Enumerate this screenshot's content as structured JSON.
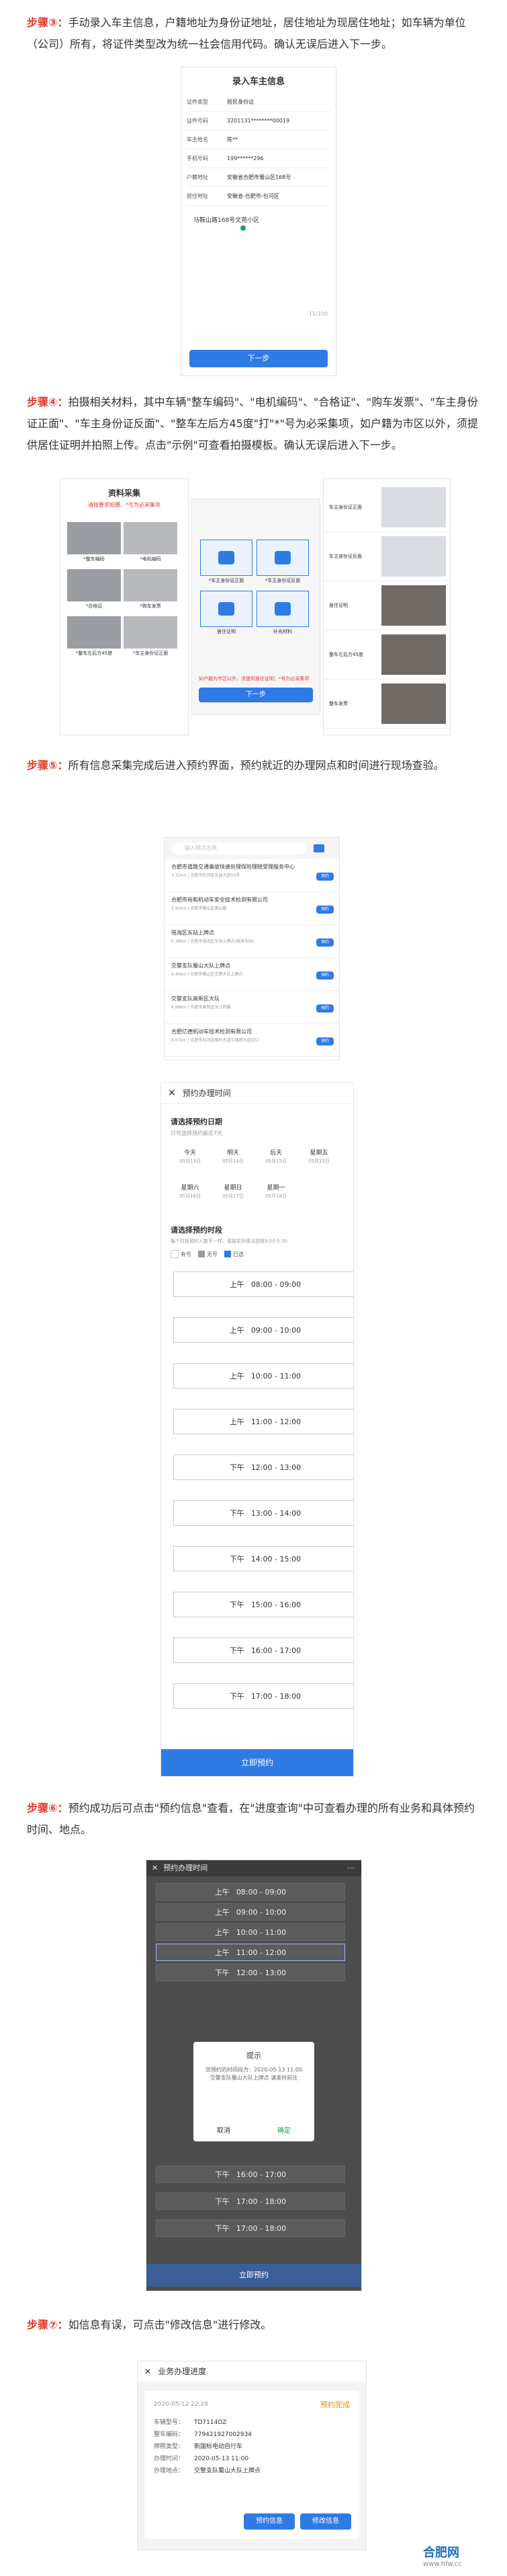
{
  "step3": {
    "label": "步骤③：",
    "text": "手动录入车主信息，户籍地址为身份证地址，居住地址为现居住地址；如车辆为单位（公司）所有，将证件类型改为统一社会信用代码。确认无误后进入下一步。"
  },
  "step4": {
    "label": "步骤④：",
    "text": "拍摄相关材料，其中车辆\"整车编码\"、\"电机编码\"、\"合格证\"、\"购车发票\"、\"车主身份证正面\"、\"车主身份证反面\"、\"整车左后方45度\"打\"*\"号为必采集项，如户籍为市区以外，须提供居住证明并拍照上传。点击\"示例\"可查看拍摄模板。确认无误后进入下一步。"
  },
  "step5": {
    "label": "步骤⑤：",
    "text": "所有信息采集完成后进入预约界面，预约就近的办理网点和时间进行现场查验。"
  },
  "step6": {
    "label": "步骤⑥：",
    "text": "预约成功后可点击\"预约信息\"查看，在\"进度查询\"中可查看办理的所有业务和具体预约时间、地点。"
  },
  "step7": {
    "label": "步骤⑦：",
    "text": "如信息有误，可点击\"修改信息\"进行修改。"
  },
  "owner_form": {
    "title": "录入车主信息",
    "fields": [
      {
        "label": "证件类型",
        "value": "居民身份证"
      },
      {
        "label": "证件号码",
        "value": "3201131********00019"
      },
      {
        "label": "车主姓名",
        "value": "陈**"
      },
      {
        "label": "手机号码",
        "value": "199******296"
      },
      {
        "label": "户籍地址",
        "value": "安徽省合肥市蜀山区168号"
      },
      {
        "label": "居住地址",
        "value": "安徽省-合肥市-包河区"
      }
    ],
    "address_detail": "马鞍山路168号文苑小区",
    "counter": "15/100",
    "next": "下一步"
  },
  "materials": {
    "title": "资料采集",
    "note": "请按要求拍摄，*号为必采集项",
    "items": [
      "*整车编码",
      "*电机编码",
      "*合格证",
      "*购车发票",
      "*整车左后方45度",
      "*车主身份证正面"
    ],
    "id_front": "*车主身份证正面",
    "id_back": "*车主身份证反面",
    "idcard_items": [
      "*车主身份证正面",
      "*车主身份证反面",
      "居住证明",
      "补充材料"
    ],
    "mid_hint": "如户籍为市区以外，须提供居住证明；*号为必采集项",
    "next": "下一步",
    "right_items": [
      "车主身份证正面",
      "车主身份证反面",
      "居住证明",
      "整车左后方45度",
      "整车发票"
    ]
  },
  "outlets": {
    "search_placeholder": "输入网点名称",
    "list": [
      {
        "name": "合肥市道路交通事故快速处理保险理赔受理服务中心",
        "meta": "3.32km | 合肥市包河区花园大道55号",
        "btn": "预约"
      },
      {
        "name": "合肥市裕和机动车安全技术检测有限公司",
        "meta": "3.95km | 合肥市蜀山区黄山路",
        "btn": "预约"
      },
      {
        "name": "瑶海区东站上牌点",
        "meta": "6.38km | 合肥市瑶海区东站上牌点(瑶海东站)",
        "btn": "预约"
      },
      {
        "name": "交警支队蜀山大队上牌点",
        "meta": "6.44km | 合肥市蜀山区交警大队上牌点",
        "btn": "预约"
      },
      {
        "name": "交警支队高新区大队",
        "meta": "6.98km | 合肥市高新区长江西路",
        "btn": "预约"
      },
      {
        "name": "合肥亿德机动车技术检测有限公司",
        "meta": "8.07km | 合肥市包河区徽州大道与锦绣大道交口",
        "btn": "预约"
      }
    ]
  },
  "booking": {
    "title": "预约办理时间",
    "date_heading": "请选择预约日期",
    "date_sub": "只可选择预约最近7天",
    "dates": [
      {
        "w": "今天",
        "d": "05月13日"
      },
      {
        "w": "明天",
        "d": "05月14日"
      },
      {
        "w": "后天",
        "d": "05月15日"
      },
      {
        "w": "星期五",
        "d": "05月15日"
      },
      {
        "w": "星期六",
        "d": "05月16日"
      },
      {
        "w": "星期日",
        "d": "05月17日"
      },
      {
        "w": "星期一",
        "d": "05月18日"
      }
    ],
    "time_heading": "请选择预约时段",
    "time_sub": "每个时段预约人数不一样，请按实际情况选择9:00-5:30",
    "legend": [
      "有号",
      "无号",
      "已选"
    ],
    "slots": [
      {
        "p": "上午",
        "t": "08:00 - 09:00"
      },
      {
        "p": "上午",
        "t": "09:00 - 10:00"
      },
      {
        "p": "上午",
        "t": "10:00 - 11:00"
      },
      {
        "p": "上午",
        "t": "11:00 - 12:00"
      },
      {
        "p": "下午",
        "t": "12:00 - 13:00"
      },
      {
        "p": "下午",
        "t": "13:00 - 14:00"
      },
      {
        "p": "下午",
        "t": "14:00 - 15:00"
      },
      {
        "p": "下午",
        "t": "15:00 - 16:00"
      },
      {
        "p": "下午",
        "t": "16:00 - 17:00"
      },
      {
        "p": "下午",
        "t": "17:00 - 18:00"
      }
    ],
    "submit": "立即预约"
  },
  "dialog": {
    "title": "预约办理时间",
    "slots": [
      {
        "p": "上午",
        "t": "08:00 - 09:00"
      },
      {
        "p": "上午",
        "t": "09:00 - 10:00"
      },
      {
        "p": "上午",
        "t": "10:00 - 11:00"
      },
      {
        "p": "上午",
        "t": "11:00 - 12:00"
      },
      {
        "p": "下午",
        "t": "12:00 - 13:00"
      },
      {
        "p": "下午",
        "t": "16:00 - 17:00"
      },
      {
        "p": "下午",
        "t": "17:00 - 18:00"
      },
      {
        "p": "下午",
        "t": "17:00 - 18:00"
      }
    ],
    "modal_title": "提示",
    "modal_body": "您预约的时间段为：2020-05-13 11:00 交警支队蜀山大队上牌点 请准时前往",
    "cancel": "取消",
    "confirm": "确定",
    "submit": "立即预约"
  },
  "progress": {
    "title": "业务办理进度",
    "time": "2020-05-12 22:28",
    "status": "预约完成",
    "rows": [
      {
        "k": "车辆型号：",
        "v": "TD7114DZ"
      },
      {
        "k": "整车编码：",
        "v": "779421927002934"
      },
      {
        "k": "牌照类型：",
        "v": "新国标电动自行车"
      },
      {
        "k": "办理时间：",
        "v": "2020-05-13 11:00"
      },
      {
        "k": "办理地点：",
        "v": "交警支队蜀山大队上牌点"
      }
    ],
    "btn_info": "预约信息",
    "btn_edit": "修改信息"
  },
  "watermark": {
    "name": "合肥网",
    "url": "www.hfw.cc"
  }
}
